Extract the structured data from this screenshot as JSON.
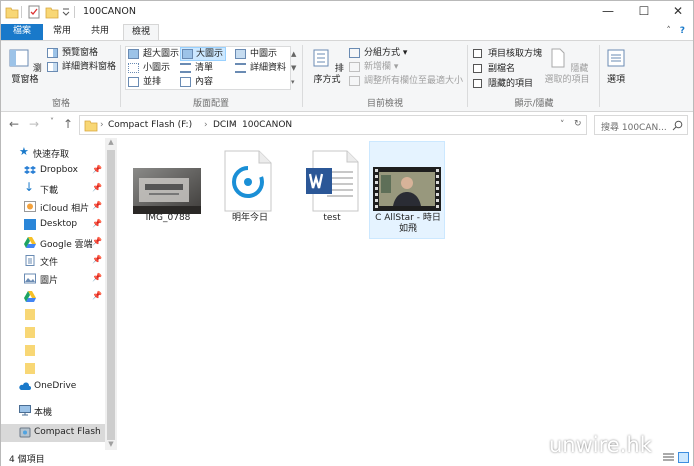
{
  "window": {
    "title": "100CANON"
  },
  "tabs": {
    "file": "檔案",
    "home": "常用",
    "share": "共用",
    "view": "檢視"
  },
  "ribbon": {
    "panes": {
      "navigation_pane": "瀏覽窗格",
      "preview_pane": "預覽窗格",
      "details_pane": "詳細資料窗格",
      "label": "窗格"
    },
    "layout": {
      "extra_large": "超大圖示",
      "large": "大圖示",
      "medium": "中圖示",
      "small": "小圖示",
      "list": "清單",
      "details": "詳細資料",
      "tiles": "並排",
      "content": "內容",
      "label": "版面配置"
    },
    "current_view": {
      "sort_by": "排序方式",
      "group_by": "分組方式",
      "add_columns": "新增欄",
      "size_columns": "調整所有欄位至最適大小",
      "label": "目前檢視"
    },
    "show_hide": {
      "item_checkboxes": "項目核取方塊",
      "file_extensions": "副檔名",
      "hidden_items": "隱藏的項目",
      "hide_selected_1": "隱藏",
      "hide_selected_2": "選取的項目",
      "options": "選項",
      "label": "顯示/隱藏"
    }
  },
  "address": {
    "crumbs": [
      "Compact Flash (F:)",
      "DCIM",
      "100CANON"
    ],
    "search_placeholder": "搜尋 100CAN..."
  },
  "nav": {
    "quick_access": "快速存取",
    "items": [
      "Dropbox",
      "下載",
      "iCloud 相片",
      "Desktop",
      "Google 雲端",
      "文件",
      "圖片"
    ],
    "onedrive": "OneDrive",
    "this_pc": "本機",
    "compact_flash": "Compact Flash (F"
  },
  "files": [
    {
      "name": "IMG_0788",
      "type": "photo"
    },
    {
      "name": "明年今日",
      "type": "audio"
    },
    {
      "name": "test",
      "type": "word"
    },
    {
      "name": "C AllStar - 時日如飛",
      "type": "video"
    }
  ],
  "status": {
    "count": "4 個項目"
  },
  "watermark": "unwire.hk",
  "colors": {
    "accent": "#1979ca",
    "selection": "#cce8ff",
    "folder": "#f8d775"
  }
}
